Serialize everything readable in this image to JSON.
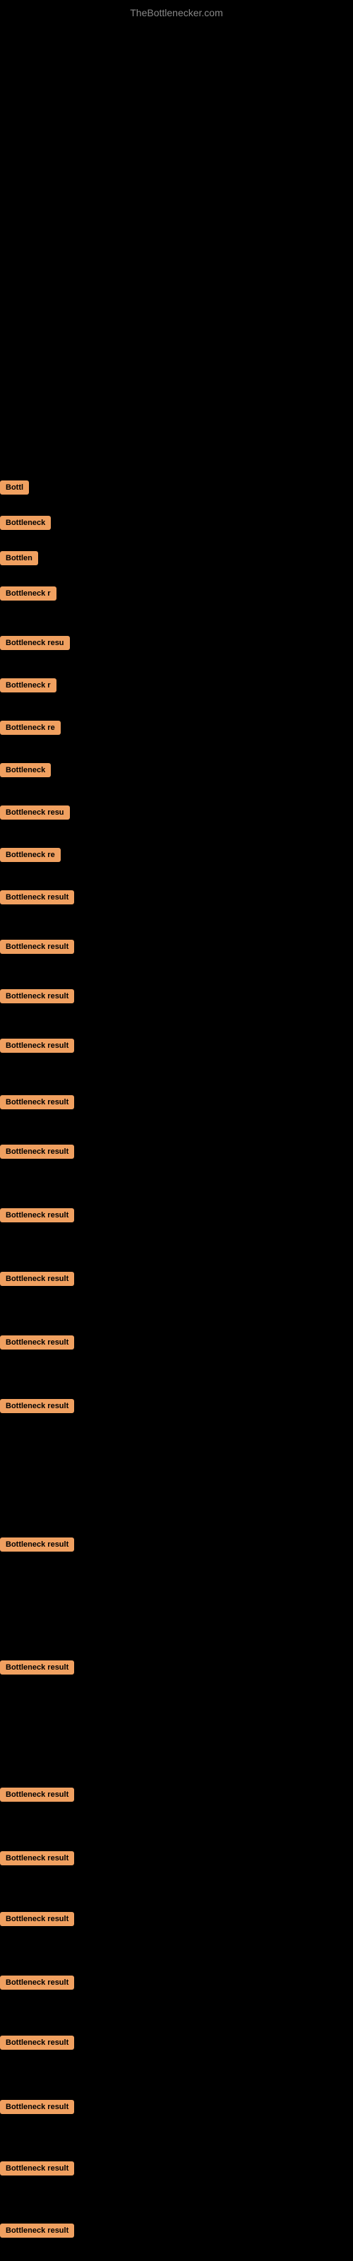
{
  "site": {
    "title": "TheBottlenecker.com"
  },
  "badges": [
    {
      "id": 1,
      "label": "Bottl",
      "widthClass": "w-short",
      "posClass": "badge-1"
    },
    {
      "id": 2,
      "label": "Bottleneck",
      "widthClass": "w-medium",
      "posClass": "badge-2"
    },
    {
      "id": 3,
      "label": "Bottlen",
      "widthClass": "w-short",
      "posClass": "badge-3"
    },
    {
      "id": 4,
      "label": "Bottleneck r",
      "widthClass": "w-medium",
      "posClass": "badge-4"
    },
    {
      "id": 5,
      "label": "Bottleneck resu",
      "widthClass": "w-long",
      "posClass": "badge-5"
    },
    {
      "id": 6,
      "label": "Bottleneck r",
      "widthClass": "w-medium",
      "posClass": "badge-6"
    },
    {
      "id": 7,
      "label": "Bottleneck re",
      "widthClass": "w-long",
      "posClass": "badge-7"
    },
    {
      "id": 8,
      "label": "Bottleneck",
      "widthClass": "w-medium",
      "posClass": "badge-8"
    },
    {
      "id": 9,
      "label": "Bottleneck resu",
      "widthClass": "w-long",
      "posClass": "badge-9"
    },
    {
      "id": 10,
      "label": "Bottleneck re",
      "widthClass": "w-long",
      "posClass": "badge-10"
    },
    {
      "id": 11,
      "label": "Bottleneck result",
      "widthClass": "w-full",
      "posClass": "badge-11"
    },
    {
      "id": 12,
      "label": "Bottleneck result",
      "widthClass": "w-full",
      "posClass": "badge-12"
    },
    {
      "id": 13,
      "label": "Bottleneck result",
      "widthClass": "w-full",
      "posClass": "badge-13"
    },
    {
      "id": 14,
      "label": "Bottleneck result",
      "widthClass": "w-full",
      "posClass": "badge-14"
    },
    {
      "id": 15,
      "label": "Bottleneck result",
      "widthClass": "w-full",
      "posClass": "badge-15"
    },
    {
      "id": 16,
      "label": "Bottleneck result",
      "widthClass": "w-full",
      "posClass": "badge-16"
    },
    {
      "id": 17,
      "label": "Bottleneck result",
      "widthClass": "w-full",
      "posClass": "badge-17"
    },
    {
      "id": 18,
      "label": "Bottleneck result",
      "widthClass": "w-full",
      "posClass": "badge-18"
    },
    {
      "id": 19,
      "label": "Bottleneck result",
      "widthClass": "w-full",
      "posClass": "badge-19"
    },
    {
      "id": 20,
      "label": "Bottleneck result",
      "widthClass": "w-full",
      "posClass": "badge-20"
    },
    {
      "id": 21,
      "label": "Bottleneck result",
      "widthClass": "w-full",
      "posClass": "badge-21"
    },
    {
      "id": 22,
      "label": "Bottleneck result",
      "widthClass": "w-full",
      "posClass": "badge-22"
    },
    {
      "id": 23,
      "label": "Bottleneck result",
      "widthClass": "w-full",
      "posClass": "badge-23"
    },
    {
      "id": 24,
      "label": "Bottleneck result",
      "widthClass": "w-full",
      "posClass": "badge-24"
    },
    {
      "id": 25,
      "label": "Bottleneck result",
      "widthClass": "w-full",
      "posClass": "badge-25"
    },
    {
      "id": 26,
      "label": "Bottleneck result",
      "widthClass": "w-full",
      "posClass": "badge-26"
    },
    {
      "id": 27,
      "label": "Bottleneck result",
      "widthClass": "w-full",
      "posClass": "badge-27"
    },
    {
      "id": 28,
      "label": "Bottleneck result",
      "widthClass": "w-full",
      "posClass": "badge-28"
    },
    {
      "id": 29,
      "label": "Bottleneck result",
      "widthClass": "w-full",
      "posClass": "badge-29"
    },
    {
      "id": 30,
      "label": "Bottleneck result",
      "widthClass": "w-full",
      "posClass": "badge-30"
    }
  ]
}
